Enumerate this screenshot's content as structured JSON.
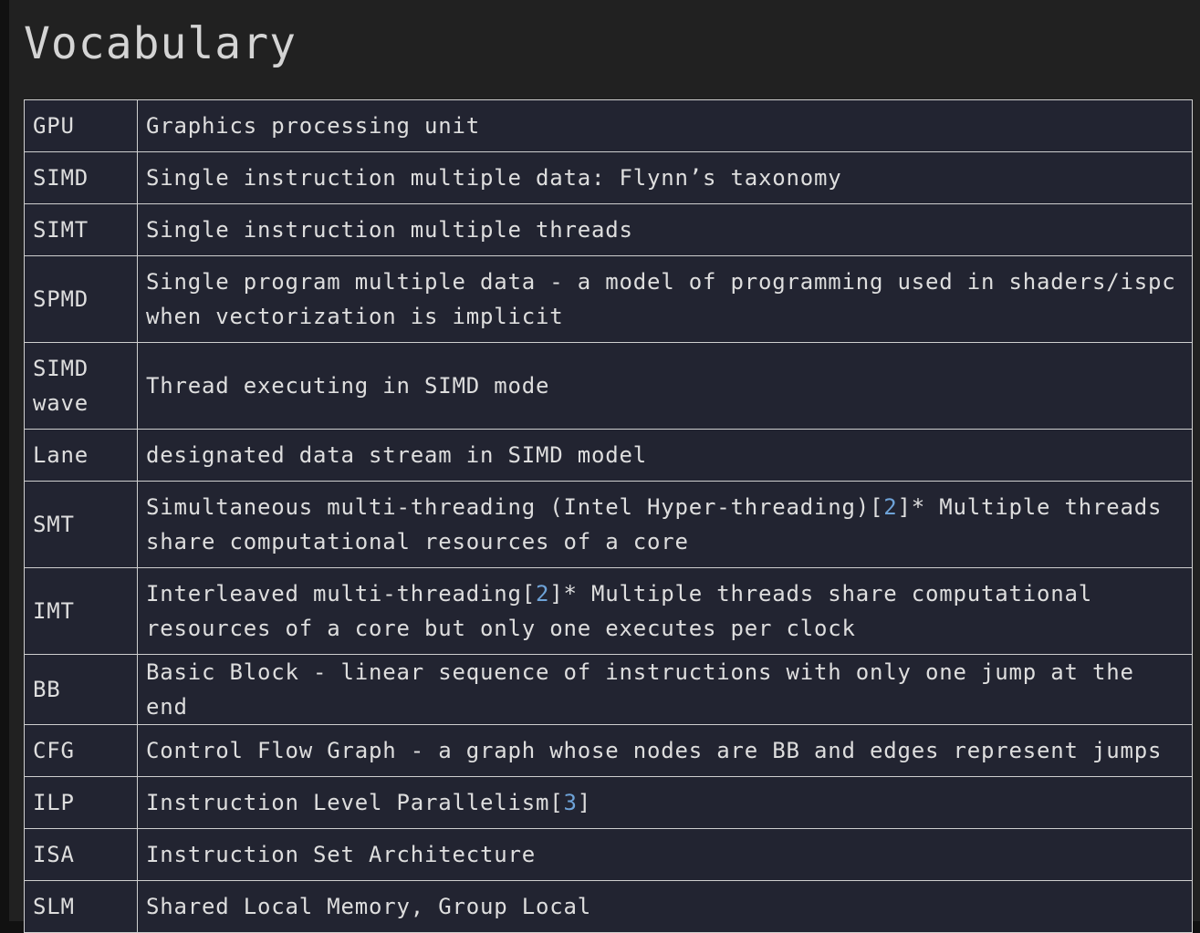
{
  "title": "Vocabulary",
  "rows": [
    {
      "term": "GPU",
      "def": "Graphics processing unit"
    },
    {
      "term": "SIMD",
      "def": "Single instruction multiple data: Flynn’s taxonomy"
    },
    {
      "term": "SIMT",
      "def": "Single instruction multiple threads"
    },
    {
      "term": "SPMD",
      "def": "Single program multiple data - a model of programming used in shaders/ispc when vectorization is implicit"
    },
    {
      "term": "SIMD wave",
      "def": "Thread executing in SIMD mode"
    },
    {
      "term": "Lane",
      "def": "designated data stream in SIMD model"
    },
    {
      "term": "SMT",
      "def_pre": "Simultaneous multi-threading (Intel Hyper-threading)[",
      "ref": "2",
      "def_post": "]* Multiple threads share computational resources of a core"
    },
    {
      "term": "IMT",
      "def_pre": "Interleaved multi-threading[",
      "ref": "2",
      "def_post": "]* Multiple threads share computational resources of a core but only one executes per clock"
    },
    {
      "term": "BB",
      "def": "Basic Block - linear sequence of instructions with only one jump at the end"
    },
    {
      "term": "CFG",
      "def": "Control Flow Graph - a graph whose nodes are BB and edges represent jumps"
    },
    {
      "term": "ILP",
      "def_pre": "Instruction Level Parallelism[",
      "ref": "3",
      "def_post": "]"
    },
    {
      "term": "ISA",
      "def": "Instruction Set Architecture"
    },
    {
      "term": "SLM",
      "def": "Shared Local Memory, Group Local"
    }
  ]
}
